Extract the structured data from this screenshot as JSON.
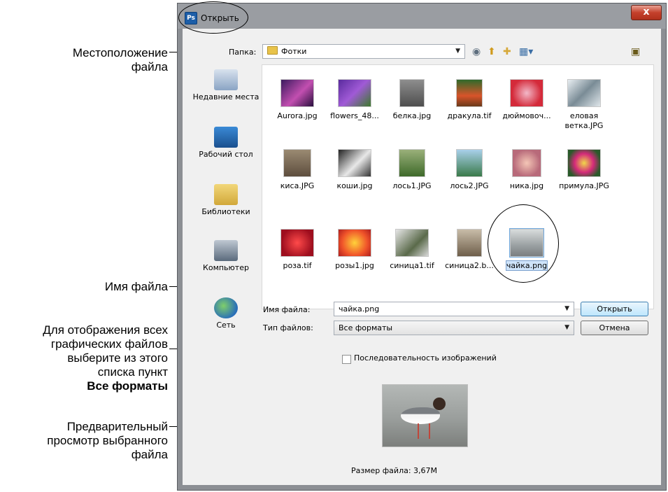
{
  "annotations": {
    "location": [
      "Местоположение",
      "файла"
    ],
    "filename": [
      "Имя файла"
    ],
    "formats": [
      "Для отображения всех",
      "графических файлов",
      "выберите из этого",
      "списка пункт",
      "Все форматы"
    ],
    "preview": [
      "Предварительный",
      "просмотр выбранного",
      "файла"
    ]
  },
  "dialog": {
    "title": "Открыть",
    "app_icon_text": "Ps",
    "close_symbol": "x",
    "folder_label": "Папка:",
    "folder_value": "Фотки",
    "places": [
      {
        "label": "Недавние места",
        "icon": "recent-places-icon"
      },
      {
        "label": "Рабочий стол",
        "icon": "desktop-icon"
      },
      {
        "label": "Библиотеки",
        "icon": "libraries-icon"
      },
      {
        "label": "Компьютер",
        "icon": "computer-icon"
      },
      {
        "label": "Сеть",
        "icon": "network-icon"
      }
    ],
    "files": [
      [
        "Aurora.jpg",
        "flowers_48...",
        "белка.jpg",
        "дракула.tif",
        "дюймовоч...",
        "еловая ветка.JPG"
      ],
      [
        "киса.JPG",
        "коши.jpg",
        "лось1.JPG",
        "лось2.JPG",
        "ника.jpg",
        "примула.JPG"
      ],
      [
        "роза.tif",
        "розы1.jpg",
        "синица1.tif",
        "синица2.b...",
        "чайка.png"
      ]
    ],
    "selected_file": "чайка.png",
    "filename_label": "Имя файла:",
    "filename_value": "чайка.png",
    "filetype_label": "Тип файлов:",
    "filetype_value": "Все форматы",
    "open_button": "Открыть",
    "cancel_button": "Отмена",
    "sequence_checkbox": "Последовательность изображений",
    "sequence_checked": false,
    "file_size": "Размер файла: 3,67М"
  },
  "colors": {
    "selection_fill": "#cfe4fa",
    "window_frame": "#8c8f94",
    "client_bg": "#f0f0f0"
  }
}
